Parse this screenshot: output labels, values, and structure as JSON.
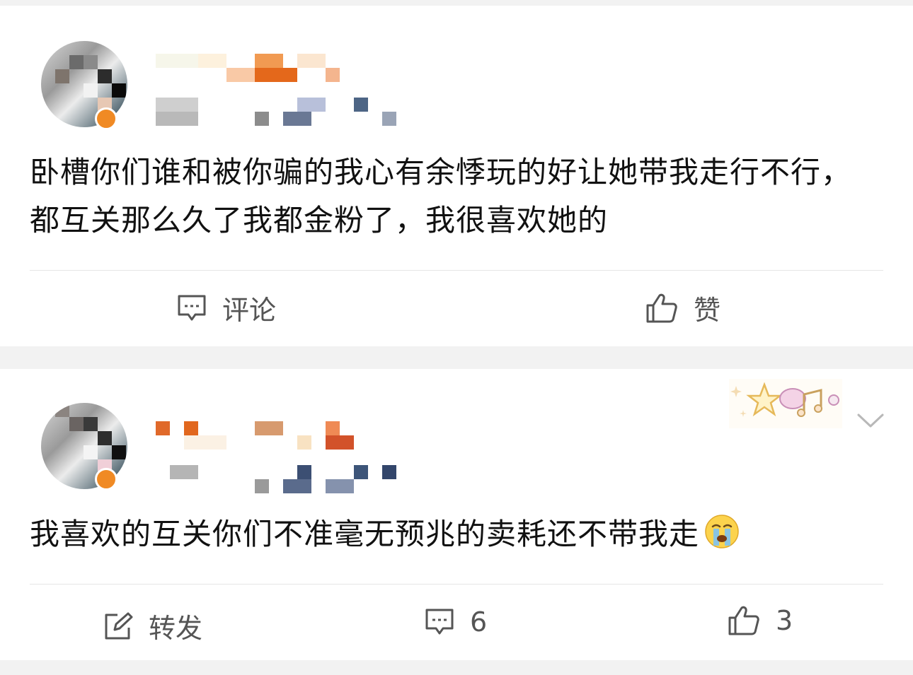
{
  "posts": [
    {
      "content": "卧槽你们谁和被你骗的我心有余悸玩的好让她带我走行不行，都互关那么久了我都金粉了，我很喜欢她的",
      "actions": {
        "comment_label": "评论",
        "like_label": "赞"
      }
    },
    {
      "content": "我喜欢的互关你们不准毫无预兆的卖耗还不带我走",
      "content_emoji": "crying-face-emoji",
      "actions": {
        "repost_label": "转发",
        "comment_count": "6",
        "like_count": "3"
      }
    }
  ],
  "icons": [
    "comment-icon",
    "thumbs-up-icon",
    "repost-icon",
    "chevron-down-icon",
    "star-music-sticker",
    "verified-badge"
  ],
  "colors": {
    "text": "#111111",
    "action": "#555555",
    "badge": "#f08a24",
    "separator": "#f2f2f2"
  }
}
